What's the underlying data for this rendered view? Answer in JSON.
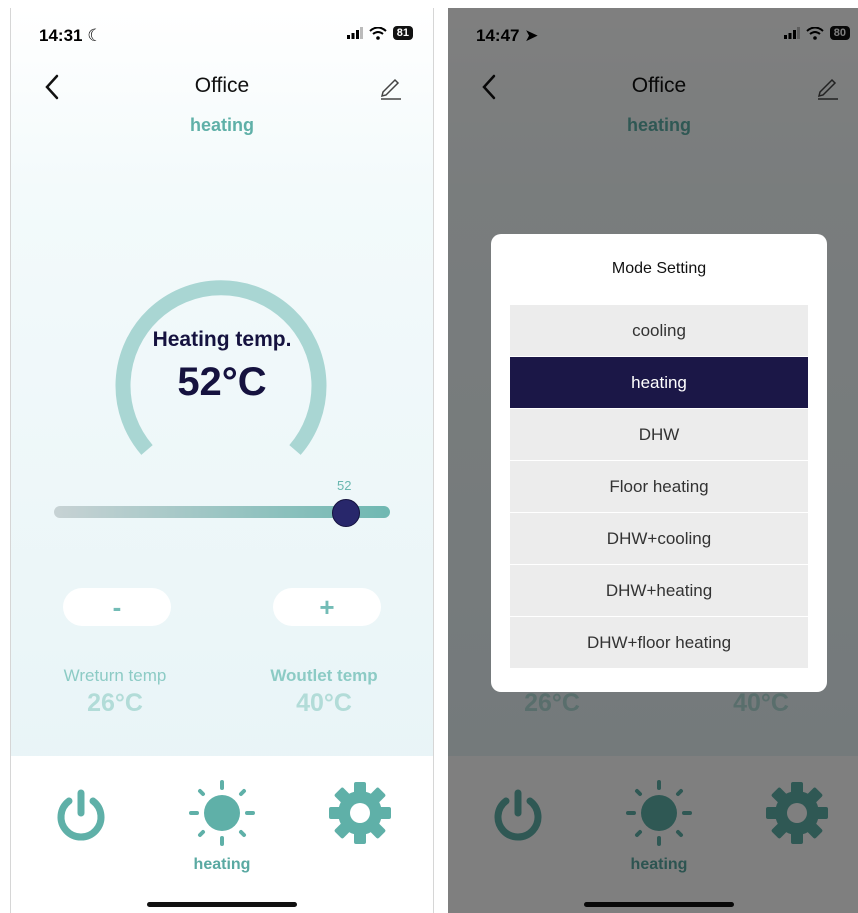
{
  "left": {
    "status_time": "14:31",
    "battery": "81",
    "title": "Office",
    "mode": "heating",
    "gauge_label": "Heating temp.",
    "gauge_value": "52°C",
    "slider_value_label": "52",
    "slider_value": 52,
    "minus_label": "-",
    "plus_label": "+",
    "return_label": "Wreturn temp",
    "return_value": "26°C",
    "outlet_label": "Woutlet temp",
    "outlet_value": "40°C",
    "nav_label": "heating"
  },
  "right": {
    "status_time": "14:47",
    "battery": "80",
    "title": "Office",
    "mode": "heating",
    "return_value": "26°C",
    "outlet_value": "40°C",
    "nav_label": "heating",
    "modal_title": "Mode Setting",
    "options": [
      "cooling",
      "heating",
      "DHW",
      "Floor heating",
      "DHW+cooling",
      "DHW+heating",
      "DHW+floor heating"
    ],
    "selected": "heating"
  },
  "colors": {
    "accent": "#5fb0a8",
    "dark": "#15123f",
    "selected_bg": "#1b1747"
  },
  "icons": [
    "moon-icon",
    "location-arrow-icon",
    "signal-icon",
    "wifi-icon",
    "battery-icon",
    "back-chevron-icon",
    "edit-pencil-icon",
    "power-icon",
    "sun-icon",
    "gear-icon"
  ]
}
